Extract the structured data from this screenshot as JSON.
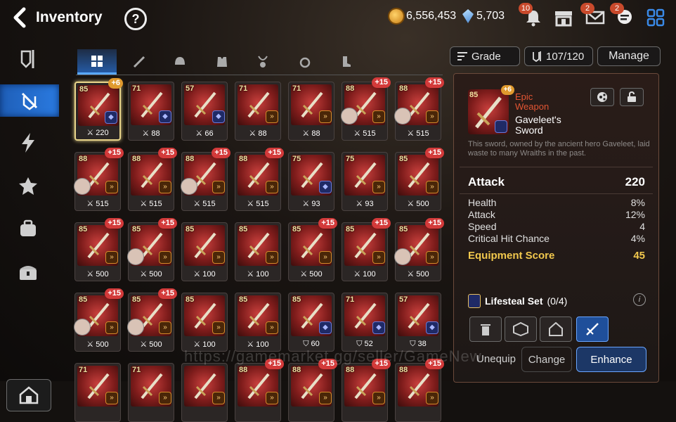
{
  "header": {
    "title": "Inventory",
    "help": "?"
  },
  "currency": {
    "gold": "6,556,453",
    "crystals": "5,703"
  },
  "notifications": {
    "bell": "10",
    "mail": "2",
    "chat": "2"
  },
  "tabs": [
    {
      "name": "all"
    },
    {
      "name": "weapon"
    },
    {
      "name": "helmet"
    },
    {
      "name": "armor"
    },
    {
      "name": "necklace"
    },
    {
      "name": "ring"
    },
    {
      "name": "boots"
    }
  ],
  "toolbar": {
    "sort_label": "Grade",
    "capacity": "107/120",
    "manage_label": "Manage"
  },
  "items": [
    {
      "lvl": "85",
      "plus": "+6",
      "set": "blue",
      "stat": "220",
      "stat_icon": "attack",
      "portrait": false
    },
    {
      "lvl": "71",
      "plus": "",
      "set": "blue",
      "stat": "88",
      "stat_icon": "attack",
      "portrait": false
    },
    {
      "lvl": "57",
      "plus": "",
      "set": "blue",
      "stat": "66",
      "stat_icon": "attack",
      "portrait": false
    },
    {
      "lvl": "71",
      "plus": "",
      "set": "orange",
      "stat": "88",
      "stat_icon": "attack",
      "portrait": false
    },
    {
      "lvl": "71",
      "plus": "",
      "set": "orange",
      "stat": "88",
      "stat_icon": "attack",
      "portrait": false
    },
    {
      "lvl": "88",
      "plus": "+15",
      "set": "orange",
      "stat": "515",
      "stat_icon": "attack",
      "portrait": true
    },
    {
      "lvl": "88",
      "plus": "+15",
      "set": "orange",
      "stat": "515",
      "stat_icon": "attack",
      "portrait": true
    },
    {
      "lvl": "88",
      "plus": "+15",
      "set": "orange",
      "stat": "515",
      "stat_icon": "attack",
      "portrait": true
    },
    {
      "lvl": "88",
      "plus": "+15",
      "set": "orange",
      "stat": "515",
      "stat_icon": "attack",
      "portrait": false
    },
    {
      "lvl": "88",
      "plus": "+15",
      "set": "orange",
      "stat": "515",
      "stat_icon": "attack",
      "portrait": true
    },
    {
      "lvl": "88",
      "plus": "+15",
      "set": "orange",
      "stat": "515",
      "stat_icon": "attack",
      "portrait": false
    },
    {
      "lvl": "75",
      "plus": "",
      "set": "blue",
      "stat": "93",
      "stat_icon": "attack",
      "portrait": false
    },
    {
      "lvl": "75",
      "plus": "",
      "set": "orange",
      "stat": "93",
      "stat_icon": "attack",
      "portrait": false
    },
    {
      "lvl": "85",
      "plus": "+15",
      "set": "orange",
      "stat": "500",
      "stat_icon": "attack",
      "portrait": false
    },
    {
      "lvl": "85",
      "plus": "+15",
      "set": "orange",
      "stat": "500",
      "stat_icon": "attack",
      "portrait": false
    },
    {
      "lvl": "85",
      "plus": "+15",
      "set": "orange",
      "stat": "500",
      "stat_icon": "attack",
      "portrait": true
    },
    {
      "lvl": "85",
      "plus": "",
      "set": "orange",
      "stat": "100",
      "stat_icon": "attack",
      "portrait": false
    },
    {
      "lvl": "85",
      "plus": "",
      "set": "orange",
      "stat": "100",
      "stat_icon": "attack",
      "portrait": false
    },
    {
      "lvl": "85",
      "plus": "+15",
      "set": "orange",
      "stat": "500",
      "stat_icon": "attack",
      "portrait": false
    },
    {
      "lvl": "85",
      "plus": "+15",
      "set": "orange",
      "stat": "100",
      "stat_icon": "attack",
      "portrait": false
    },
    {
      "lvl": "85",
      "plus": "+15",
      "set": "orange",
      "stat": "500",
      "stat_icon": "attack",
      "portrait": true
    },
    {
      "lvl": "85",
      "plus": "+15",
      "set": "orange",
      "stat": "500",
      "stat_icon": "attack",
      "portrait": true
    },
    {
      "lvl": "85",
      "plus": "+15",
      "set": "orange",
      "stat": "500",
      "stat_icon": "attack",
      "portrait": true
    },
    {
      "lvl": "85",
      "plus": "",
      "set": "orange",
      "stat": "100",
      "stat_icon": "attack",
      "portrait": false
    },
    {
      "lvl": "85",
      "plus": "",
      "set": "orange",
      "stat": "100",
      "stat_icon": "attack",
      "portrait": false
    },
    {
      "lvl": "85",
      "plus": "",
      "set": "blue",
      "stat": "60",
      "stat_icon": "defense",
      "portrait": false
    },
    {
      "lvl": "71",
      "plus": "",
      "set": "blue",
      "stat": "52",
      "stat_icon": "defense",
      "portrait": false
    },
    {
      "lvl": "57",
      "plus": "",
      "set": "blue",
      "stat": "38",
      "stat_icon": "defense",
      "portrait": false
    },
    {
      "lvl": "71",
      "plus": "",
      "set": "orange",
      "stat": "",
      "stat_icon": "attack",
      "portrait": false
    },
    {
      "lvl": "71",
      "plus": "",
      "set": "orange",
      "stat": "",
      "stat_icon": "attack",
      "portrait": false
    },
    {
      "lvl": "",
      "plus": "",
      "set": "orange",
      "stat": "",
      "stat_icon": "attack",
      "portrait": false
    },
    {
      "lvl": "88",
      "plus": "+15",
      "set": "orange",
      "stat": "",
      "stat_icon": "attack",
      "portrait": false
    },
    {
      "lvl": "88",
      "plus": "+15",
      "set": "orange",
      "stat": "",
      "stat_icon": "attack",
      "portrait": false
    },
    {
      "lvl": "88",
      "plus": "+15",
      "set": "orange",
      "stat": "",
      "stat_icon": "attack",
      "portrait": false
    },
    {
      "lvl": "88",
      "plus": "+15",
      "set": "orange",
      "stat": "",
      "stat_icon": "attack",
      "portrait": false
    }
  ],
  "detail": {
    "level": "85",
    "plus": "+6",
    "rarity": "Epic Weapon",
    "name": "Gaveleet's Sword",
    "description": "This sword, owned by the ancient hero Gaveleet, laid waste to many Wraiths in the past.",
    "main_stat": {
      "label": "Attack",
      "value": "220"
    },
    "substats": [
      {
        "label": "Health",
        "value": "8%"
      },
      {
        "label": "Attack",
        "value": "12%"
      },
      {
        "label": "Speed",
        "value": "4"
      },
      {
        "label": "Critical Hit Chance",
        "value": "4%"
      }
    ],
    "score": {
      "label": "Equipment Score",
      "value": "45"
    },
    "set": {
      "name": "Lifesteal Set",
      "count": "(0/4)"
    },
    "buttons": {
      "unequip": "Unequip",
      "change": "Change",
      "enhance": "Enhance"
    }
  },
  "watermark": "https://gamemarket.gg/seller/GameNew",
  "colors": {
    "accent": "#2a7ae0",
    "rarity_epic": "#e25533",
    "score": "#f1c84d",
    "upgrade_badge": "#d33a3a"
  }
}
